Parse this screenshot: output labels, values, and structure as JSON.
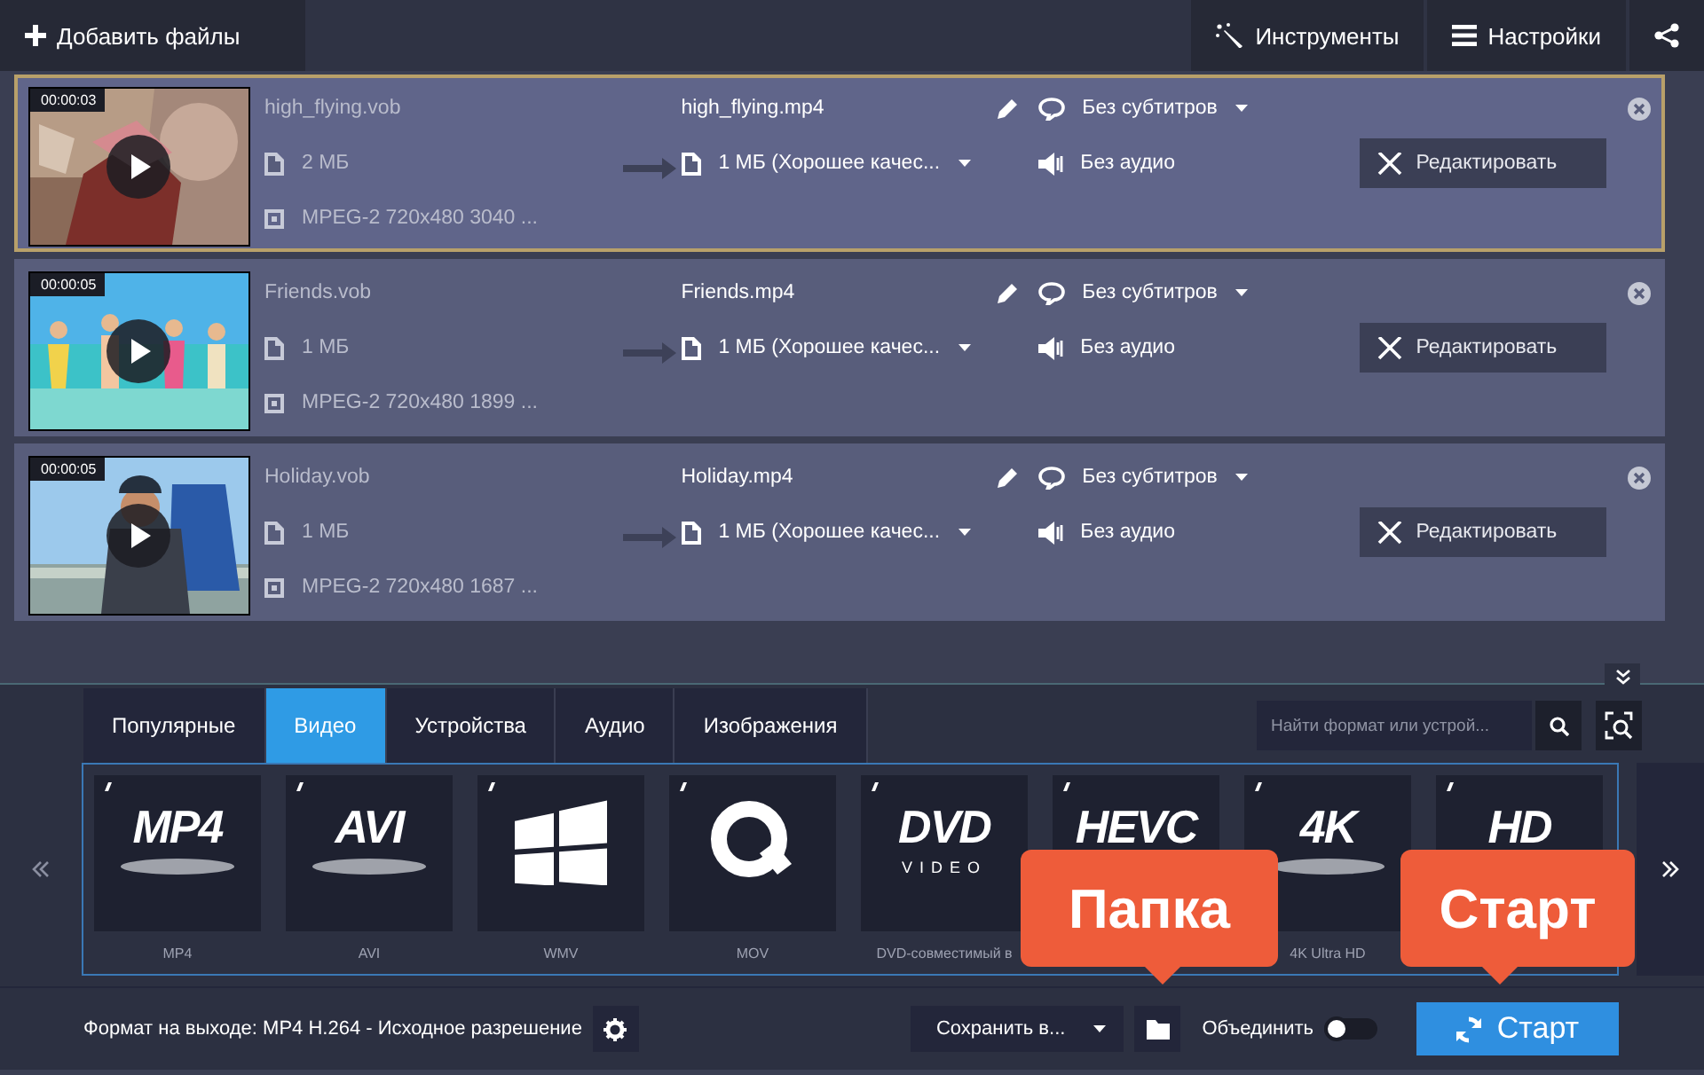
{
  "top_bar": {
    "add_files": "Добавить файлы",
    "tools": "Инструменты",
    "settings": "Настройки"
  },
  "files": [
    {
      "selected": true,
      "timecode": "00:00:03",
      "source_name": "high_flying.vob",
      "source_size": "2 МБ",
      "source_info": "MPEG-2 720x480 3040 ...",
      "output_name": "high_flying.mp4",
      "output_size": "1 МБ (Хорошее качес...",
      "subtitles": "Без субтитров",
      "audio": "Без аудио",
      "edit": "Редактировать"
    },
    {
      "selected": false,
      "timecode": "00:00:05",
      "source_name": "Friends.vob",
      "source_size": "1 МБ",
      "source_info": "MPEG-2 720x480 1899 ...",
      "output_name": "Friends.mp4",
      "output_size": "1 МБ (Хорошее качес...",
      "subtitles": "Без субтитров",
      "audio": "Без аудио",
      "edit": "Редактировать"
    },
    {
      "selected": false,
      "timecode": "00:00:05",
      "source_name": "Holiday.vob",
      "source_size": "1 МБ",
      "source_info": "MPEG-2 720x480 1687 ...",
      "output_name": "Holiday.mp4",
      "output_size": "1 МБ (Хорошее качес...",
      "subtitles": "Без субтитров",
      "audio": "Без аудио",
      "edit": "Редактировать"
    }
  ],
  "format_panel": {
    "tabs": [
      {
        "label": "Популярные",
        "selected": false
      },
      {
        "label": "Видео",
        "selected": true
      },
      {
        "label": "Устройства",
        "selected": false
      },
      {
        "label": "Аудио",
        "selected": false
      },
      {
        "label": "Изображения",
        "selected": false
      }
    ],
    "search": {
      "placeholder": "Найти формат или устрой..."
    },
    "formats": [
      {
        "kind": "text",
        "logo": "MP4",
        "oval": true,
        "label": "MP4"
      },
      {
        "kind": "text",
        "logo": "AVI",
        "oval": true,
        "label": "AVI"
      },
      {
        "kind": "windows",
        "label": "WMV"
      },
      {
        "kind": "quicktime",
        "label": "MOV"
      },
      {
        "kind": "text",
        "logo": "DVD",
        "sub": "VIDEO",
        "label": "DVD-совместимый в"
      },
      {
        "kind": "text",
        "logo": "HEVC"
      },
      {
        "kind": "text",
        "logo": "4K",
        "oval": true,
        "label": "4K Ultra HD"
      },
      {
        "kind": "text",
        "logo": "HD"
      }
    ]
  },
  "bottom_bar": {
    "output_format": "Формат на выходе: MP4 H.264 - Исходное разрешение",
    "save_to": "Сохранить в...",
    "merge": {
      "label": "Объединить",
      "on": false
    },
    "start": "Старт"
  },
  "callouts": [
    {
      "label": "Папка"
    },
    {
      "label": "Старт"
    }
  ]
}
